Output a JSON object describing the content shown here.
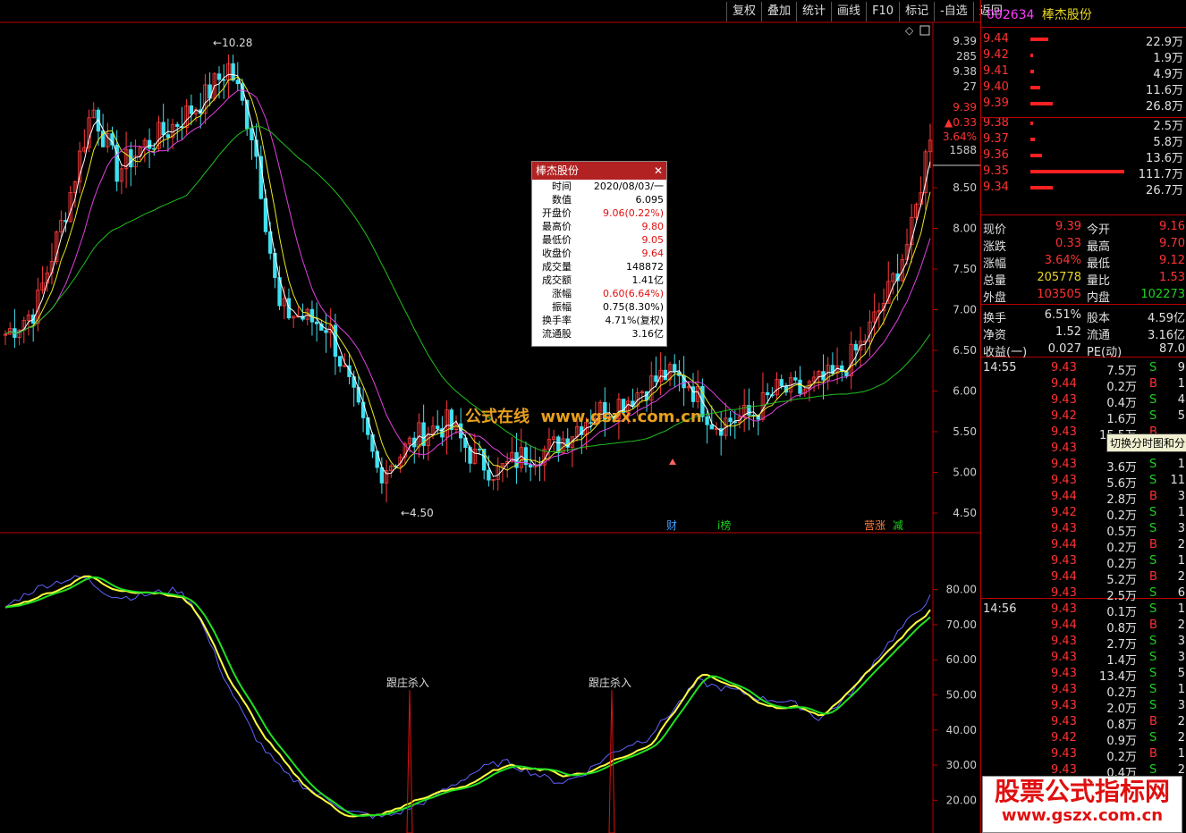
{
  "toolbar": [
    "复权",
    "叠加",
    "统计",
    "画线",
    "F10",
    "标记",
    "-自选",
    "返回"
  ],
  "stock": {
    "code": "002634",
    "name": "棒杰股份"
  },
  "chart_data": [
    {
      "type": "line",
      "title": "",
      "y_ticks": [
        "9.39",
        "285",
        "9.38",
        "27",
        "9.39",
        "▲0.33",
        "3.64%",
        "1588",
        "8.50",
        "8.00",
        "7.50",
        "7.00",
        "6.50",
        "6.00",
        "5.50",
        "5.00",
        "4.50"
      ],
      "annotations": {
        "high": "10.28",
        "low": "4.50"
      },
      "markers": [
        "财",
        "i榜",
        "营涨",
        "减"
      ],
      "ylim": [
        4.5,
        10.28
      ]
    },
    {
      "type": "line",
      "y_ticks": [
        "80.00",
        "70.00",
        "60.00",
        "50.00",
        "40.00",
        "30.00",
        "20.00"
      ],
      "ylim": [
        15,
        85
      ],
      "annotations": [
        "跟庄杀入",
        "跟庄杀入"
      ]
    }
  ],
  "watermark": "公式在线  www.gszx.com.cn",
  "popup": {
    "title": "棒杰股份",
    "rows": [
      {
        "k": "时间",
        "v": "2020/08/03/一",
        "c": "black"
      },
      {
        "k": "数值",
        "v": "6.095",
        "c": "black"
      },
      {
        "k": "开盘价",
        "v": "9.06(0.22%)",
        "c": "red"
      },
      {
        "k": "最高价",
        "v": "9.80",
        "c": "red"
      },
      {
        "k": "最低价",
        "v": "9.05",
        "c": "red"
      },
      {
        "k": "收盘价",
        "v": "9.64",
        "c": "red"
      },
      {
        "k": "成交量",
        "v": "148872",
        "c": "black"
      },
      {
        "k": "成交额",
        "v": "1.41亿",
        "c": "black"
      },
      {
        "k": "涨幅",
        "v": "0.60(6.64%)",
        "c": "red"
      },
      {
        "k": "振幅",
        "v": "0.75(8.30%)",
        "c": "black"
      },
      {
        "k": "换手率",
        "v": "4.71%(复权)",
        "c": "black"
      },
      {
        "k": "流通股",
        "v": "3.16亿",
        "c": "black"
      }
    ]
  },
  "order_book": [
    {
      "p": "9.44",
      "v": "22.9万",
      "bar": 0.19
    },
    {
      "p": "9.42",
      "v": "1.9万",
      "bar": 0.02
    },
    {
      "p": "9.41",
      "v": "4.9万",
      "bar": 0.04
    },
    {
      "p": "9.40",
      "v": "11.6万",
      "bar": 0.1
    },
    {
      "p": "9.39",
      "v": "26.8万",
      "bar": 0.24
    },
    {
      "p": "9.38",
      "v": "2.5万",
      "bar": 0.02
    },
    {
      "p": "9.37",
      "v": "5.8万",
      "bar": 0.05
    },
    {
      "p": "9.36",
      "v": "13.6万",
      "bar": 0.12
    },
    {
      "p": "9.35",
      "v": "111.7万",
      "bar": 1.0
    },
    {
      "p": "9.34",
      "v": "26.7万",
      "bar": 0.24
    }
  ],
  "quote": [
    {
      "l1": "现价",
      "v1": "9.39",
      "c1": "red",
      "l2": "今开",
      "v2": "9.16",
      "c2": "red"
    },
    {
      "l1": "涨跌",
      "v1": "0.33",
      "c1": "red",
      "l2": "最高",
      "v2": "9.70",
      "c2": "red"
    },
    {
      "l1": "涨幅",
      "v1": "3.64%",
      "c1": "red",
      "l2": "最低",
      "v2": "9.12",
      "c2": "red"
    },
    {
      "l1": "总量",
      "v1": "205778",
      "c1": "yellow",
      "l2": "量比",
      "v2": "1.53",
      "c2": "red"
    },
    {
      "l1": "外盘",
      "v1": "103505",
      "c1": "red",
      "l2": "内盘",
      "v2": "102273",
      "c2": "green"
    },
    {
      "l1": "换手",
      "v1": "6.51%",
      "c1": "white",
      "l2": "股本",
      "v2": "4.59亿",
      "c2": "white"
    },
    {
      "l1": "净资",
      "v1": "1.52",
      "c1": "white",
      "l2": "流通",
      "v2": "3.16亿",
      "c2": "white"
    },
    {
      "l1": "收益(一)",
      "v1": "0.027",
      "c1": "white",
      "l2": "PE(动)",
      "v2": "87.0",
      "c2": "white"
    }
  ],
  "tooltip": "切换分时图和分",
  "ticks_1455_time": "14:55",
  "ticks_1455": [
    {
      "p": "9.43",
      "v": "7.5万",
      "s": "S",
      "n": "9"
    },
    {
      "p": "9.44",
      "v": "0.2万",
      "s": "B",
      "n": "1"
    },
    {
      "p": "9.43",
      "v": "0.4万",
      "s": "S",
      "n": "4"
    },
    {
      "p": "9.42",
      "v": "1.6万",
      "s": "S",
      "n": "5"
    },
    {
      "p": "9.43",
      "v": "15.5万",
      "s": "B",
      "n": ""
    },
    {
      "p": "9.43",
      "v": "1",
      "s": "",
      "n": ""
    },
    {
      "p": "9.43",
      "v": "3.6万",
      "s": "S",
      "n": "1"
    },
    {
      "p": "9.43",
      "v": "5.6万",
      "s": "S",
      "n": "11"
    },
    {
      "p": "9.44",
      "v": "2.8万",
      "s": "B",
      "n": "3"
    },
    {
      "p": "9.42",
      "v": "0.2万",
      "s": "S",
      "n": "1"
    },
    {
      "p": "9.43",
      "v": "0.5万",
      "s": "S",
      "n": "3"
    },
    {
      "p": "9.44",
      "v": "0.2万",
      "s": "B",
      "n": "2"
    },
    {
      "p": "9.43",
      "v": "0.2万",
      "s": "S",
      "n": "1"
    },
    {
      "p": "9.44",
      "v": "5.2万",
      "s": "B",
      "n": "2"
    },
    {
      "p": "9.43",
      "v": "2.5万",
      "s": "S",
      "n": "6"
    }
  ],
  "ticks_1456_time": "14:56",
  "ticks_1456": [
    {
      "p": "9.43",
      "v": "0.1万",
      "s": "S",
      "n": "1"
    },
    {
      "p": "9.44",
      "v": "0.8万",
      "s": "B",
      "n": "2"
    },
    {
      "p": "9.43",
      "v": "2.7万",
      "s": "S",
      "n": "3"
    },
    {
      "p": "9.43",
      "v": "1.4万",
      "s": "S",
      "n": "3"
    },
    {
      "p": "9.43",
      "v": "13.4万",
      "s": "S",
      "n": "5"
    },
    {
      "p": "9.43",
      "v": "0.2万",
      "s": "S",
      "n": "1"
    },
    {
      "p": "9.43",
      "v": "2.0万",
      "s": "S",
      "n": "3"
    },
    {
      "p": "9.43",
      "v": "0.8万",
      "s": "B",
      "n": "2"
    },
    {
      "p": "9.42",
      "v": "0.9万",
      "s": "S",
      "n": "2"
    },
    {
      "p": "9.43",
      "v": "0.2万",
      "s": "B",
      "n": "1"
    },
    {
      "p": "9.43",
      "v": "0.4万",
      "s": "S",
      "n": "2"
    }
  ],
  "logo": {
    "line1": "股票公式指标网",
    "line2": "www.gszx.com.cn"
  }
}
